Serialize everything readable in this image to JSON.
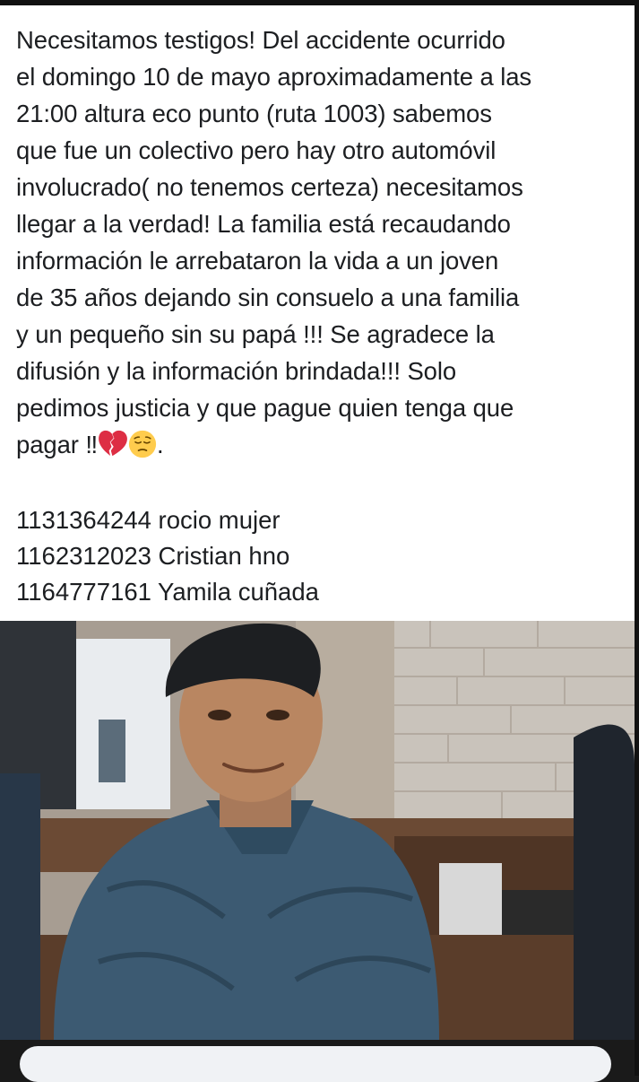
{
  "post": {
    "text_lines": [
      "Necesitamos testigos! Del accidente ocurrido",
      "el domingo 10 de mayo aproximadamente a las",
      "21:00 altura eco punto (ruta 1003) sabemos",
      "que fue un colectivo pero hay otro automóvil",
      "involucrado( no tenemos certeza) necesitamos",
      "llegar a la verdad! La familia está recaudando",
      "información le arrebataron la vida a un joven",
      "de 35 años dejando sin consuelo a una familia",
      "y un pequeño sin su papá  !!! Se agradece la",
      "difusión y la información brindada!!!  Solo",
      "pedimos justicia y que pague quien tenga que"
    ],
    "last_line_text": "pagar ‼",
    "last_line_end": ".",
    "emojis": [
      "broken-heart",
      "pensive-face"
    ],
    "contacts": [
      "1131364244 rocio mujer",
      "1162312023 Cristian hno",
      "1164777161 Yamila cuñada"
    ]
  },
  "colors": {
    "text": "#1c1e21",
    "background": "#ffffff",
    "broken_heart": "#dd2e44",
    "emoji_face": "#ffcc4d"
  }
}
